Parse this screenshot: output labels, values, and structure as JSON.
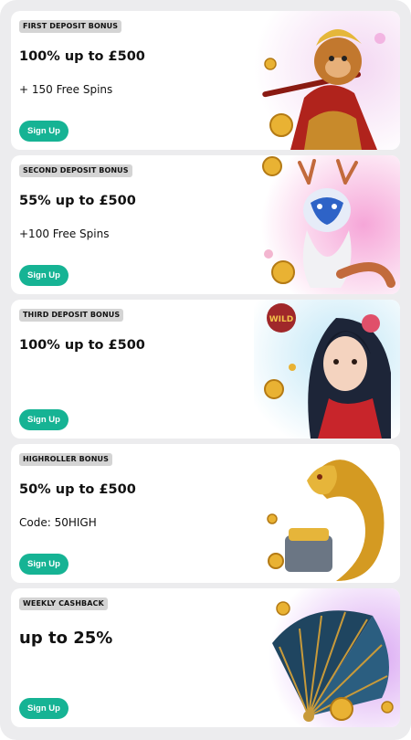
{
  "promos": [
    {
      "tag": "FIRST DEPOSIT BONUS",
      "headline": "100% up to £500",
      "subline": "+ 150 Free Spins",
      "cta": "Sign Up",
      "icon": "monkey-king-icon"
    },
    {
      "tag": "SECOND DEPOSIT BONUS",
      "headline": "55% up to £500",
      "subline": "+100 Free Spins",
      "cta": "Sign Up",
      "icon": "white-dragon-icon"
    },
    {
      "tag": "THIRD DEPOSIT BONUS",
      "headline": "100% up to £500",
      "subline": "",
      "cta": "Sign Up",
      "icon": "princess-wild-icon"
    },
    {
      "tag": "HIGHROLLER BONUS",
      "headline": "50% up to £500",
      "subline": "Code: 50HIGH",
      "cta": "Sign Up",
      "icon": "golden-dragon-icon"
    },
    {
      "tag": "WEEKLY CASHBACK",
      "headline": "up to 25%",
      "subline": "",
      "cta": "Sign Up",
      "icon": "cashback-fan-icon"
    }
  ],
  "colors": {
    "accent": "#16b394",
    "card": "#ffffff",
    "background": "#ececee",
    "tag": "#d4d4d4"
  }
}
